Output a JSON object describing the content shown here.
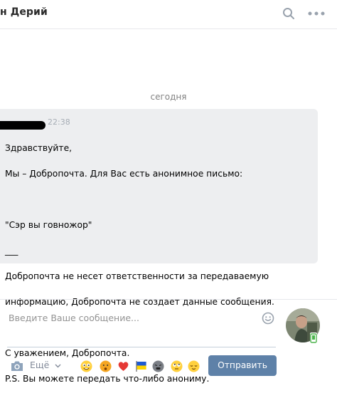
{
  "header": {
    "title": "н Дерий"
  },
  "conversation": {
    "date_separator": "сегодня",
    "message": {
      "time": "22:38",
      "lines": [
        "Здравствуйте,",
        "Мы – Добропочта. Для Вас есть анонимное письмо:",
        "",
        "\"Сэр вы говножор\"",
        "___",
        "Добропочта не несет ответственности за передаваемую",
        "информацию, Добропочта не создает данные сообщения.",
        "",
        "С уважением, Добропочта.",
        "P.S. Вы можете передать что-либо анониму."
      ]
    }
  },
  "composer": {
    "placeholder": "Введите Ваше сообщение...",
    "more_label": "Ещё",
    "send_label": "Отправить"
  },
  "colors": {
    "send_button": "#5e81a8",
    "message_bg": "#edeef0",
    "link_gray": "#828a99"
  }
}
